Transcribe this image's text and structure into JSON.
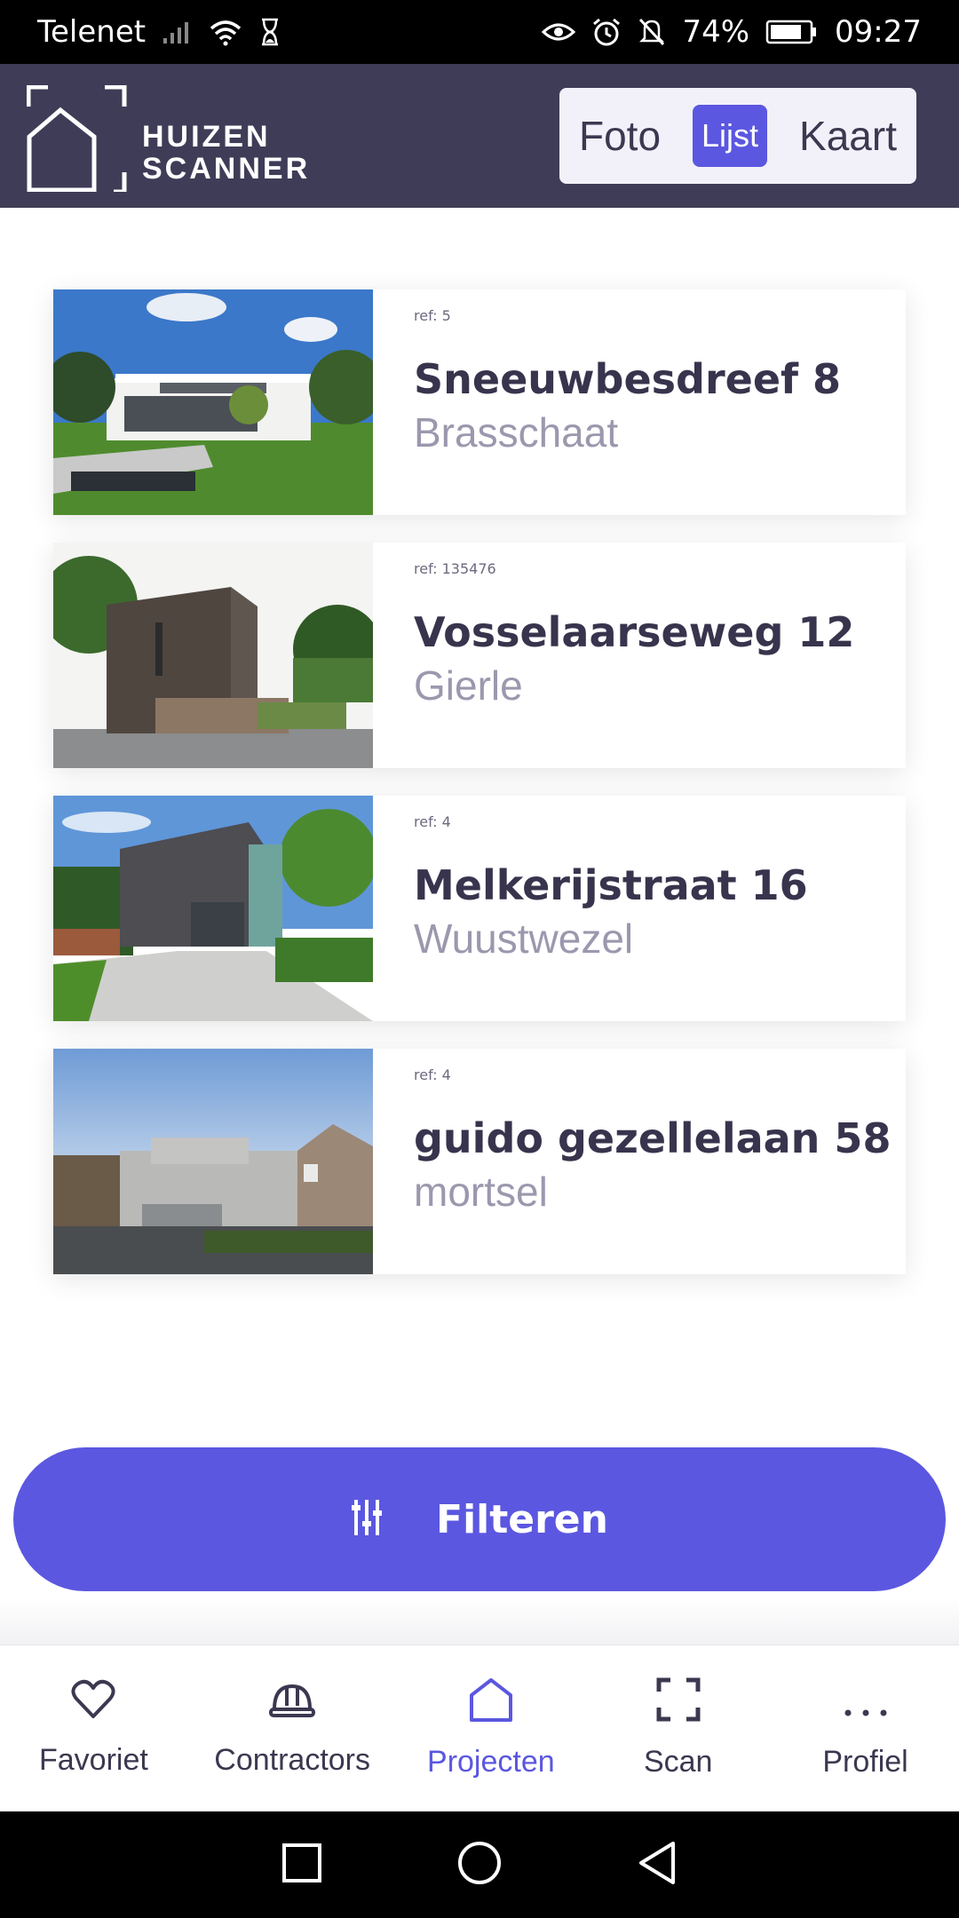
{
  "status_bar": {
    "carrier": "Telenet",
    "battery": "74%",
    "time": "09:27"
  },
  "header": {
    "logo_line1": "HUIZEN",
    "logo_line2": "SCANNER",
    "view_tabs": [
      {
        "label": "Foto",
        "active": false
      },
      {
        "label": "Lijst",
        "active": true
      },
      {
        "label": "Kaart",
        "active": false
      }
    ]
  },
  "listings": [
    {
      "ref": "ref: 5",
      "street": "Sneeuwbesdreef 8",
      "city": "Brasschaat"
    },
    {
      "ref": "ref: 135476",
      "street": "Vosselaarseweg 12",
      "city": "Gierle"
    },
    {
      "ref": "ref: 4",
      "street": "Melkerijstraat 16",
      "city": "Wuustwezel"
    },
    {
      "ref": "ref: 4",
      "street": "guido gezellelaan 58",
      "city": "mortsel"
    }
  ],
  "filter_button": {
    "label": "Filteren",
    "icon": "sliders-icon"
  },
  "bottom_nav": [
    {
      "label": "Favoriet",
      "icon": "heart-icon",
      "active": false
    },
    {
      "label": "Contractors",
      "icon": "hardhat-icon",
      "active": false
    },
    {
      "label": "Projecten",
      "icon": "house-icon",
      "active": true
    },
    {
      "label": "Scan",
      "icon": "scan-frame-icon",
      "active": false
    },
    {
      "label": "Profiel",
      "icon": "more-dots-icon",
      "active": false
    }
  ],
  "colors": {
    "header_bg": "#3f3c57",
    "accent": "#5b57e0",
    "text_dark": "#38344d",
    "text_muted": "#9b98ae"
  }
}
